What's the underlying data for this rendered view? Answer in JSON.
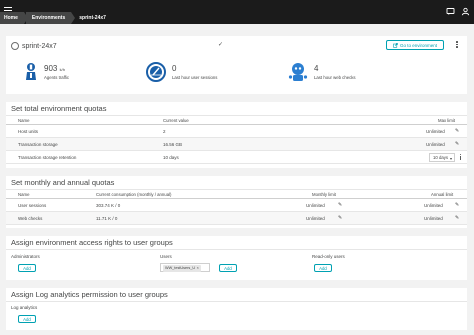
{
  "topbar": {
    "breadcrumbs": [
      "Home",
      "Environments",
      "sprint-24x7"
    ]
  },
  "header": {
    "env_name": "sprint-24x7",
    "checkmark": "✓",
    "goto_label": "Go to environment"
  },
  "stats": [
    {
      "value": "903",
      "unit": "k/h",
      "label": "Agents traffic",
      "icon": "agent-icon",
      "color": "#1a5fa8"
    },
    {
      "value": "0",
      "unit": "",
      "label": "Last hour user sessions",
      "icon": "gauge-icon",
      "color": "#1a5fa8"
    },
    {
      "value": "4",
      "unit": "",
      "label": "Last hour web checks",
      "icon": "robot-icon",
      "color": "#2c7fd1"
    }
  ],
  "quotas": {
    "title": "Set total environment quotas",
    "columns": {
      "name": "Name",
      "current": "Current value",
      "max": "Max limit"
    },
    "rows": [
      {
        "name": "Host units",
        "current": "2",
        "max": "Unlimited"
      },
      {
        "name": "Transaction storage",
        "current": "16.56 GB",
        "max": "Unlimited"
      },
      {
        "name": "Transaction storage retention",
        "current": "10 days",
        "max": "10 days"
      }
    ]
  },
  "monthly": {
    "title": "Set monthly and annual quotas",
    "columns": {
      "name": "Name",
      "current": "Current consumption (monthly / annual)",
      "monthly": "Monthly limit",
      "annual": "Annual limit"
    },
    "rows": [
      {
        "name": "User sessions",
        "current": "303.74 K / 0",
        "monthly": "Unlimited",
        "annual": "Unlimited"
      },
      {
        "name": "Web checks",
        "current": "11.71 K / 0",
        "monthly": "Unlimited",
        "annual": "Unlimited"
      }
    ]
  },
  "access": {
    "title": "Assign environment access rights to user groups",
    "admins_label": "Administrators",
    "users_label": "Users",
    "readonly_label": "Read-only users",
    "users_chip": "WW_testUsers_U",
    "add_label": "Add"
  },
  "log": {
    "title": "Assign Log analytics permission to user groups",
    "label": "Log analytics",
    "add_label": "Add"
  },
  "colors": {
    "accent": "#00a1b2",
    "topbar": "#1b1b1b",
    "breadcrumb": "#454646"
  }
}
